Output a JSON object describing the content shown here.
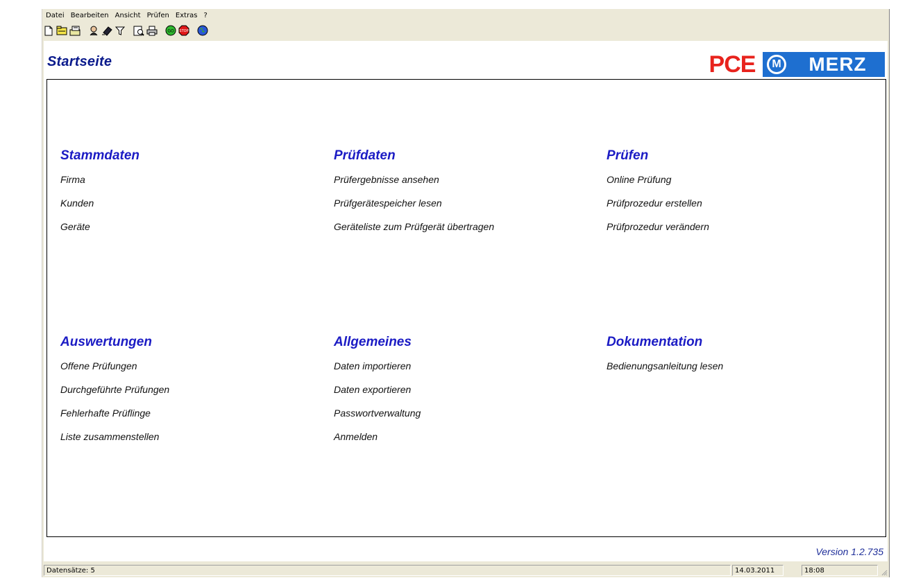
{
  "menubar": {
    "items": [
      "Datei",
      "Bearbeiten",
      "Ansicht",
      "Prüfen",
      "Extras",
      "?"
    ]
  },
  "toolbar": {
    "icons": [
      "new-document-icon",
      "open-folder-icon",
      "save-icon",
      "person-icon",
      "eraser-icon",
      "filter-icon",
      "print-preview-icon",
      "print-icon",
      "go-icon",
      "stop-icon",
      "globe-icon"
    ]
  },
  "page": {
    "title": "Startseite",
    "logo": {
      "pce": "PCE",
      "m": "M",
      "merz": "MERZ"
    },
    "version": "Version 1.2.735"
  },
  "sections": {
    "stammdaten": {
      "heading": "Stammdaten",
      "links": [
        "Firma",
        "Kunden",
        "Geräte"
      ]
    },
    "pruefdaten": {
      "heading": "Prüfdaten",
      "links": [
        "Prüfergebnisse ansehen",
        "Prüfgerätespeicher lesen",
        "Geräteliste zum Prüfgerät übertragen"
      ]
    },
    "pruefen": {
      "heading": "Prüfen",
      "links": [
        "Online Prüfung",
        "Prüfprozedur erstellen",
        "Prüfprozedur verändern"
      ]
    },
    "auswertungen": {
      "heading": "Auswertungen",
      "links": [
        "Offene Prüfungen",
        "Durchgeführte Prüfungen",
        "Fehlerhafte Prüflinge",
        "Liste zusammenstellen"
      ]
    },
    "allgemeines": {
      "heading": "Allgemeines",
      "links": [
        "Daten importieren",
        "Daten exportieren",
        "Passwortverwaltung",
        "Anmelden"
      ]
    },
    "dokumentation": {
      "heading": "Dokumentation",
      "links": [
        "Bedienungsanleitung lesen"
      ]
    }
  },
  "statusbar": {
    "records": "Datensätze: 5",
    "date": "14.03.2011",
    "time": "18:08"
  },
  "colors": {
    "heading": "#1b1bc4",
    "title": "#0a1a8c",
    "logo_red": "#e8231d",
    "logo_blue": "#1e6fd0"
  }
}
